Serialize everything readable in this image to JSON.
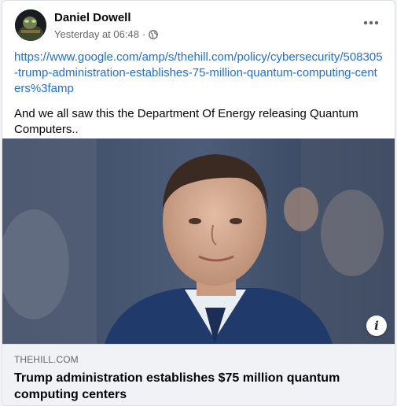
{
  "post": {
    "author": "Daniel Dowell",
    "timestamp": "Yesterday at 06:48",
    "separator": "·",
    "privacy_icon": "globe-icon",
    "more_icon": "ellipsis-icon",
    "link_url": "https://www.google.com/amp/s/thehill.com/policy/cybersecurity/508305-trump-administration-establishes-75-million-quantum-computing-centers%3famp",
    "caption": "And we all saw this the Department Of Energy releasing Quantum Computers.."
  },
  "preview": {
    "domain": "THEHILL.COM",
    "headline": "Trump administration establishes $75 million quantum computing centers",
    "info_icon": "info-icon",
    "info_glyph": "i"
  },
  "colors": {
    "link": "#216fdb",
    "secondary_text": "#65676b",
    "preview_bg": "#f0f2f5"
  }
}
